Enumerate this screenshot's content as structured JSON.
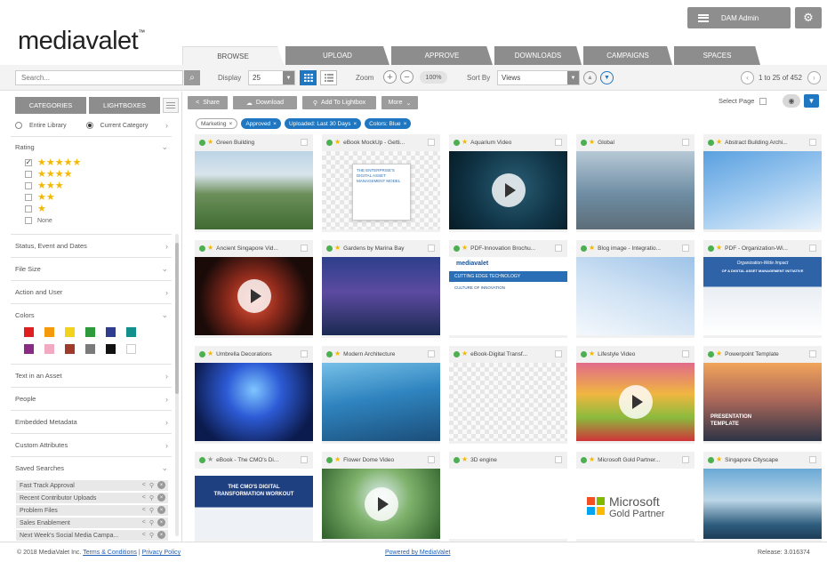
{
  "app": {
    "logo": "mediavalet",
    "logo_tm": "™",
    "user_menu_label": "DAM Admin"
  },
  "tabs": [
    {
      "label": "BROWSE",
      "active": true
    },
    {
      "label": "UPLOAD"
    },
    {
      "label": "APPROVE"
    },
    {
      "label": "DOWNLOADS"
    },
    {
      "label": "CAMPAIGNS"
    },
    {
      "label": "SPACES"
    }
  ],
  "toolbar": {
    "search_placeholder": "Search...",
    "display_label": "Display",
    "display_value": "25",
    "zoom_label": "Zoom",
    "zoom_value": "100%",
    "sort_label": "Sort By",
    "sort_value": "Views",
    "pager_text": "1 to 25 of 452"
  },
  "sidebar": {
    "tabs": [
      "CATEGORIES",
      "LIGHTBOXES"
    ],
    "scope": {
      "entire": "Entire Library",
      "current": "Current Category"
    },
    "rating_title": "Rating",
    "rating_rows": [
      {
        "stars": "★★★★★",
        "checked": true
      },
      {
        "stars": "★★★★",
        "checked": false
      },
      {
        "stars": "★★★",
        "checked": false
      },
      {
        "stars": "★★",
        "checked": false
      },
      {
        "stars": "★",
        "checked": false
      }
    ],
    "rating_none": "None",
    "sections": {
      "status": "Status, Event and Dates",
      "filesize": "File Size",
      "action": "Action and User",
      "colors": "Colors",
      "text": "Text in an Asset",
      "people": "People",
      "embedded": "Embedded Metadata",
      "custom": "Custom Attributes",
      "saved": "Saved Searches"
    },
    "colors": [
      "#e02020",
      "#f59a0c",
      "#f2d21b",
      "#2e9a3c",
      "#2f3d8f",
      "#138f8c",
      "#8a2b86",
      "#f2a9c2",
      "#a03a2a",
      "#7a7a7a",
      "#111111",
      "#ffffff"
    ],
    "saved_searches": [
      "Fast Track Approval",
      "Recent Contributor Uploads",
      "Problem Files",
      "Sales Enablement",
      "Next Week's Social Media Campa..."
    ]
  },
  "actions": {
    "share": "Share",
    "download": "Download",
    "lightbox": "Add To Lightbox",
    "more": "More",
    "select_page": "Select Page"
  },
  "filters": [
    {
      "label": "Marketing",
      "style": "grey"
    },
    {
      "label": "Approved",
      "style": "blue"
    },
    {
      "label": "Uploaded: Last 30 Days",
      "style": "blue"
    },
    {
      "label": "Colors: Blue",
      "style": "blue"
    }
  ],
  "assets": [
    {
      "title": "Green Building",
      "starred": true
    },
    {
      "title": "eBook MockUp - Getti...",
      "starred": true,
      "ebook_cover": "THE ENTERPRISE'S DIGITAL ASSET MANAGEMENT MODEL"
    },
    {
      "title": "Aquarium Video",
      "starred": true,
      "video": true
    },
    {
      "title": "Global",
      "starred": true
    },
    {
      "title": "Abstract Building Archi...",
      "starred": true
    },
    {
      "title": "Ancient Singapore Vid...",
      "starred": true,
      "video": true
    },
    {
      "title": "Gardens by Marina Bay",
      "starred": true
    },
    {
      "title": "PDF-Innovation Brochu...",
      "starred": true,
      "brochure_logo": "mediavalet",
      "brochure_heading": "CUTTING EDGE TECHNOLOGY",
      "brochure_sub": "CULTURE OF INNOVATION"
    },
    {
      "title": "Blog image - Integratio...",
      "starred": true
    },
    {
      "title": "PDF - Organization-Wi...",
      "starred": true,
      "cover_line1": "Organization-Wide Impact",
      "cover_line2": "OF A DIGITAL ASSET MANAGEMENT INITIATIVE"
    },
    {
      "title": "Umbrella Decorations",
      "starred": true
    },
    {
      "title": "Modern Architecture",
      "starred": true
    },
    {
      "title": "eBook-Digital Transf...",
      "starred": true
    },
    {
      "title": "Lifestyle Video",
      "starred": true,
      "video": true
    },
    {
      "title": "Powerpoint Template",
      "starred": true,
      "template_text": "PRESENTATION TEMPLATE"
    },
    {
      "title": "eBook - The CMO's Di...",
      "starred": false,
      "ebook_title": "THE CMO'S DIGITAL TRANSFORMATION WORKOUT"
    },
    {
      "title": "Flower Dome Video",
      "starred": true,
      "video": true
    },
    {
      "title": "3D engine",
      "starred": true
    },
    {
      "title": "Microsoft Gold Partner...",
      "starred": true,
      "ms_line1": "Microsoft",
      "ms_line2": "Gold Partner"
    },
    {
      "title": "Singapore Cityscape",
      "starred": true
    }
  ],
  "footer": {
    "copyright": "© 2018 MediaValet Inc.",
    "terms": "Terms & Conditions",
    "privacy": "Privacy Policy",
    "powered": "Powered by MediaValet",
    "release": "Release: 3.016374"
  }
}
